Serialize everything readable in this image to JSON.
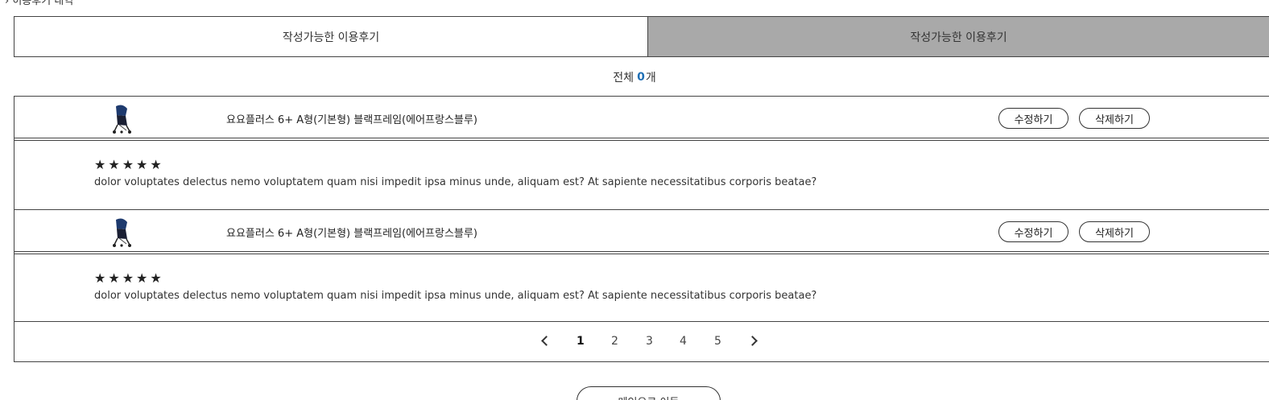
{
  "breadcrumb": {
    "text": "› 이용후기 내역"
  },
  "tabs": [
    {
      "label": "작성가능한 이용후기"
    },
    {
      "label": "작성가능한 이용후기"
    }
  ],
  "total": {
    "prefix": "전체",
    "count": "0",
    "suffix": "개"
  },
  "reviews": [
    {
      "product_name": "요요플러스 6+ A형(기본형) 블랙프레임(에어프랑스블루)",
      "edit_label": "수정하기",
      "delete_label": "삭제하기",
      "stars": "★★★★★",
      "rating": 5,
      "text": "dolor voluptates delectus nemo voluptatem quam nisi impedit ipsa minus unde, aliquam est? At sapiente necessitatibus corporis beatae?"
    },
    {
      "product_name": "요요플러스 6+ A형(기본형) 블랙프레임(에어프랑스블루)",
      "edit_label": "수정하기",
      "delete_label": "삭제하기",
      "stars": "★★★★★",
      "rating": 5,
      "text": "dolor voluptates delectus nemo voluptatem quam nisi impedit ipsa minus unde, aliquam est? At sapiente necessitatibus corporis beatae?"
    }
  ],
  "pagination": {
    "pages": [
      "1",
      "2",
      "3",
      "4",
      "5"
    ],
    "current": "1"
  },
  "bottom_button": {
    "label": "메인으로 이동"
  },
  "colors": {
    "accent": "#1f6fb5",
    "active_tab_bg": "#a9a9a9",
    "border": "#444444"
  }
}
